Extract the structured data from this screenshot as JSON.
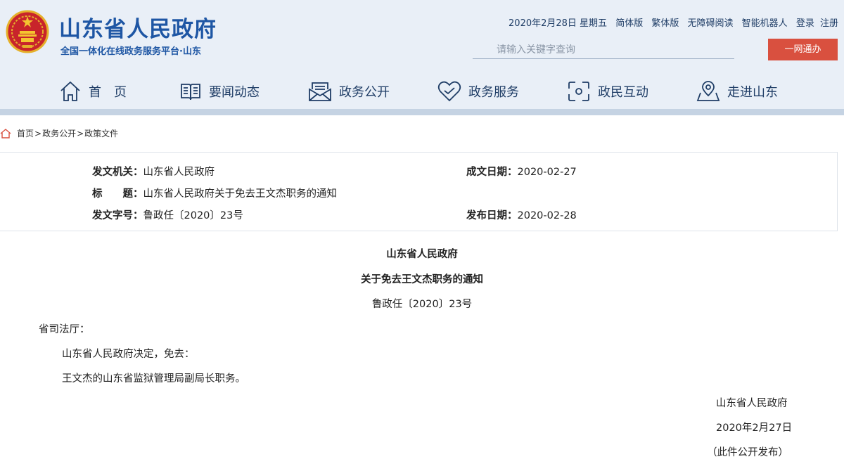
{
  "header": {
    "site_title": "山东省人民政府",
    "site_subtitle": "全国一体化在线政务服务平台·山东",
    "date": "2020年2月28日 星期五",
    "links": [
      "简体版",
      "繁体版",
      "无障碍阅读",
      "智能机器人",
      "登录",
      "注册"
    ],
    "search_placeholder": "请输入关键字查询",
    "onestop_label": "一网通办"
  },
  "nav": {
    "items": [
      {
        "label": "首　页",
        "icon": "home-icon"
      },
      {
        "label": "要闻动态",
        "icon": "book-icon"
      },
      {
        "label": "政务公开",
        "icon": "envelope-icon"
      },
      {
        "label": "政务服务",
        "icon": "heart-icon"
      },
      {
        "label": "政民互动",
        "icon": "interaction-icon"
      },
      {
        "label": "走进山东",
        "icon": "location-icon"
      }
    ]
  },
  "breadcrumb": {
    "items": [
      "首页",
      "政务公开",
      "政策文件"
    ],
    "separator": ">"
  },
  "meta": {
    "issuer_label": "发文机关：",
    "issuer_value": "山东省人民政府",
    "created_label": "成文日期：",
    "created_value": "2020-02-27",
    "title_label": "标　　题：",
    "title_value": "山东省人民政府关于免去王文杰职务的通知",
    "docno_label": "发文字号：",
    "docno_value": "鲁政任〔2020〕23号",
    "published_label": "发布日期：",
    "published_value": "2020-02-28"
  },
  "document": {
    "heading1": "山东省人民政府",
    "heading2": "关于免去王文杰职务的通知",
    "docno": "鲁政任〔2020〕23号",
    "addressee": "省司法厅：",
    "para1": "山东省人民政府决定，免去：",
    "para2": "王文杰的山东省监狱管理局副局长职务。",
    "sign_org": "山东省人民政府",
    "sign_date": "2020年2月27日",
    "release_note": "（此件公开发布）"
  },
  "colors": {
    "brand_blue": "#1e56a4",
    "header_bg": "#e9eff7",
    "accent_red": "#d9503f"
  }
}
